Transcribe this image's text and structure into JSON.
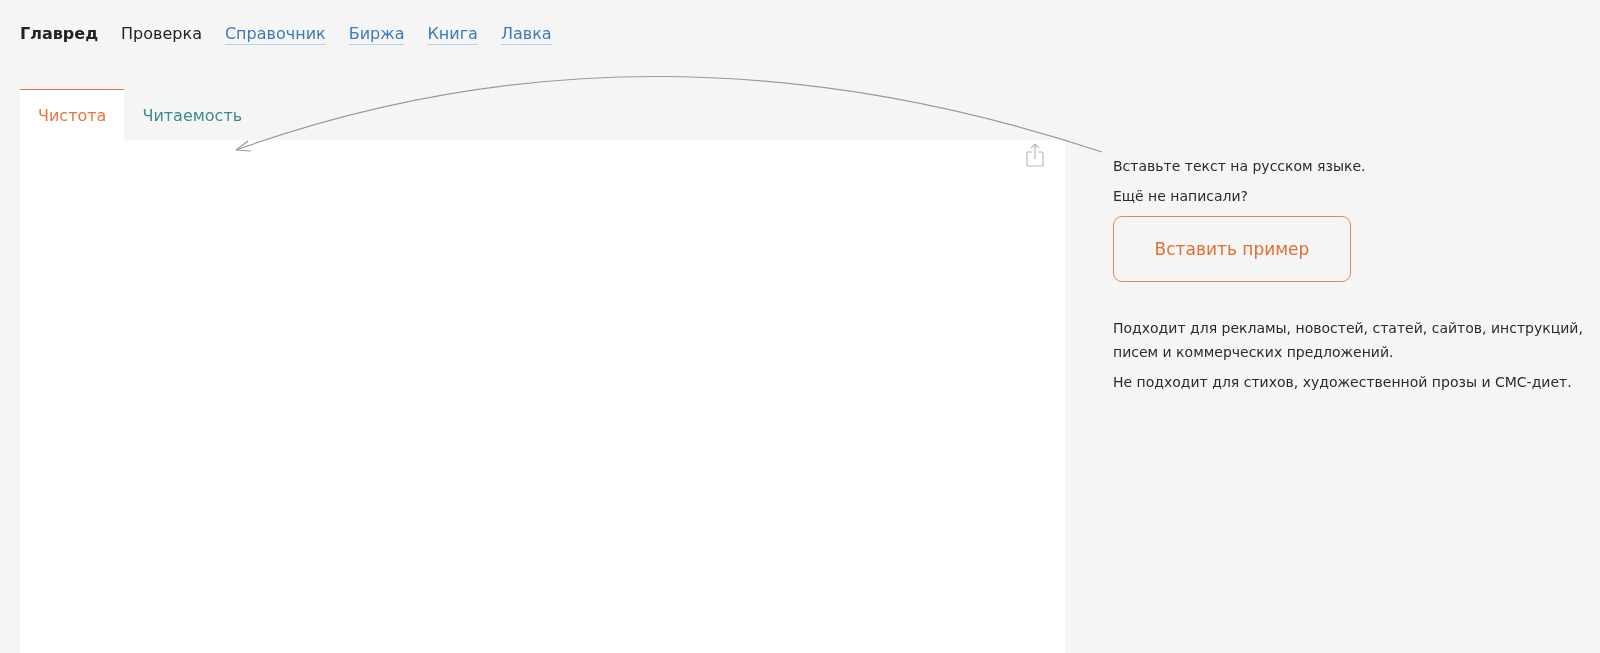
{
  "nav": [
    {
      "label": "Главред",
      "kind": "current"
    },
    {
      "label": "Проверка",
      "kind": "plain"
    },
    {
      "label": "Справочник",
      "kind": "link"
    },
    {
      "label": "Биржа",
      "kind": "link"
    },
    {
      "label": "Книга",
      "kind": "link"
    },
    {
      "label": "Лавка",
      "kind": "link"
    }
  ],
  "tabs": [
    {
      "label": "Чистота",
      "selected": true
    },
    {
      "label": "Читаемость",
      "selected": false
    }
  ],
  "sidebar": {
    "hint": "Вставьте текст на русском языке.",
    "prompt": "Ещё не написали?",
    "example_button": "Вставить пример",
    "notes": [
      "Подходит для рекламы, новостей, статей, сайтов, инструкций, писем и коммерческих предложений.",
      "Не подходит для стихов, художественной прозы и СМС-диет."
    ]
  }
}
